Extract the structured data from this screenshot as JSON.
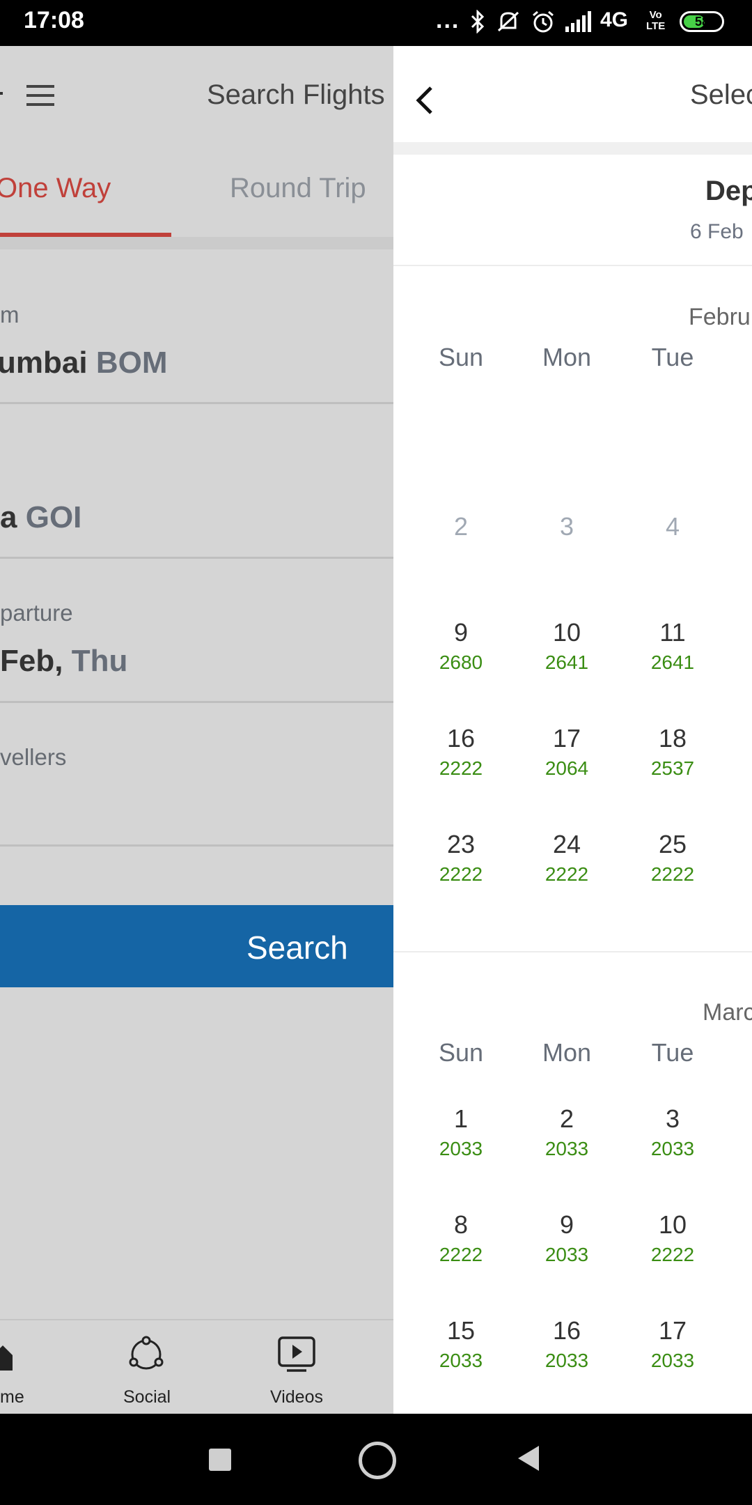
{
  "status_bar": {
    "time": "17:08",
    "dots": "...",
    "network": "4G",
    "volte_top": "Vo",
    "volte_bottom": "LTE",
    "battery": "58",
    "battery_level_percent": 58
  },
  "background_app": {
    "title": "Search Flights",
    "tabs": [
      "One Way",
      "Round Trip"
    ],
    "active_tab": "One Way",
    "from": {
      "label": "m",
      "city": "umbai",
      "code": "BOM"
    },
    "to": {
      "city": "a",
      "code": "GOI"
    },
    "departure": {
      "label": "parture",
      "date": "Feb,",
      "day": "Thu"
    },
    "travellers": {
      "label": "vellers"
    },
    "search_button": "Search",
    "bottom_nav": [
      "me",
      "Social",
      "Videos"
    ]
  },
  "calendar": {
    "header_title": "Selec",
    "departure_label": "Dep",
    "departure_date": "6 Feb",
    "weekday_headers": [
      "Sun",
      "Mon",
      "Tue"
    ],
    "months": [
      {
        "name": "Febru",
        "rows": [
          [
            {
              "day": "2",
              "price": "",
              "past": true
            },
            {
              "day": "3",
              "price": "",
              "past": true
            },
            {
              "day": "4",
              "price": "",
              "past": true
            }
          ],
          [
            {
              "day": "9",
              "price": "2680"
            },
            {
              "day": "10",
              "price": "2641"
            },
            {
              "day": "11",
              "price": "2641"
            }
          ],
          [
            {
              "day": "16",
              "price": "2222"
            },
            {
              "day": "17",
              "price": "2064"
            },
            {
              "day": "18",
              "price": "2537"
            }
          ],
          [
            {
              "day": "23",
              "price": "2222"
            },
            {
              "day": "24",
              "price": "2222"
            },
            {
              "day": "25",
              "price": "2222"
            }
          ]
        ]
      },
      {
        "name": "Marc",
        "rows": [
          [
            {
              "day": "1",
              "price": "2033"
            },
            {
              "day": "2",
              "price": "2033"
            },
            {
              "day": "3",
              "price": "2033"
            }
          ],
          [
            {
              "day": "8",
              "price": "2222"
            },
            {
              "day": "9",
              "price": "2033"
            },
            {
              "day": "10",
              "price": "2222"
            }
          ],
          [
            {
              "day": "15",
              "price": "2033"
            },
            {
              "day": "16",
              "price": "2033"
            },
            {
              "day": "17",
              "price": "2033"
            }
          ]
        ]
      }
    ]
  },
  "colors": {
    "accent_red": "#c0403a",
    "price_green": "#3a8d13",
    "search_blue": "#1565a5"
  }
}
